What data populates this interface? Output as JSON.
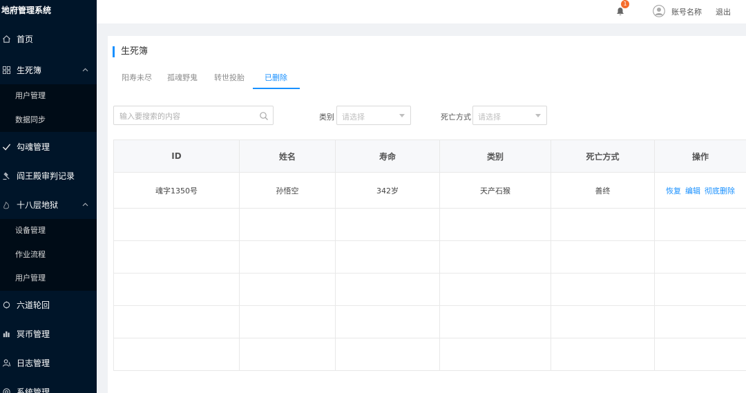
{
  "app": {
    "title": "地府管理系统"
  },
  "sidebar": {
    "items": [
      {
        "label": "首页",
        "icon": "home-icon"
      },
      {
        "label": "生死簿",
        "icon": "grid-icon",
        "expanded": true,
        "children": [
          "用户管理",
          "数据同步"
        ]
      },
      {
        "label": "勾魂管理",
        "icon": "check-icon"
      },
      {
        "label": "阎王殿审判记录",
        "icon": "gavel-icon"
      },
      {
        "label": "十八层地狱",
        "icon": "flame-icon",
        "expanded": true,
        "children": [
          "设备管理",
          "作业流程",
          "用户管理"
        ]
      },
      {
        "label": "六道轮回",
        "icon": "cycle-icon"
      },
      {
        "label": "冥币管理",
        "icon": "coins-icon"
      },
      {
        "label": "日志管理",
        "icon": "user-log-icon"
      },
      {
        "label": "系统管理",
        "icon": "settings-icon"
      }
    ]
  },
  "header": {
    "notification_count": "1",
    "account_name": "账号名称",
    "logout_label": "退出"
  },
  "page": {
    "title": "生死簿",
    "tabs": [
      {
        "label": "阳寿未尽",
        "active": false
      },
      {
        "label": "孤魂野鬼",
        "active": false
      },
      {
        "label": "转世投胎",
        "active": false
      },
      {
        "label": "已删除",
        "active": true
      }
    ],
    "filters": {
      "search_placeholder": "输入要搜索的内容",
      "category_label": "类别",
      "category_placeholder": "请选择",
      "death_label": "死亡方式",
      "death_placeholder": "请选择"
    }
  },
  "table": {
    "columns": [
      "ID",
      "姓名",
      "寿命",
      "类别",
      "死亡方式",
      "操作"
    ],
    "rows": [
      {
        "id": "魂字1350号",
        "name": "孙悟空",
        "life": "342岁",
        "category": "天产石猴",
        "death": "善终",
        "actions": [
          "恢复",
          "编辑",
          "彻底删除"
        ]
      }
    ],
    "empty_rows": 6
  },
  "colors": {
    "sidebar_bg": "#001529",
    "submenu_bg": "#000c17",
    "accent": "#1890ff",
    "badge": "#f56c2c"
  }
}
